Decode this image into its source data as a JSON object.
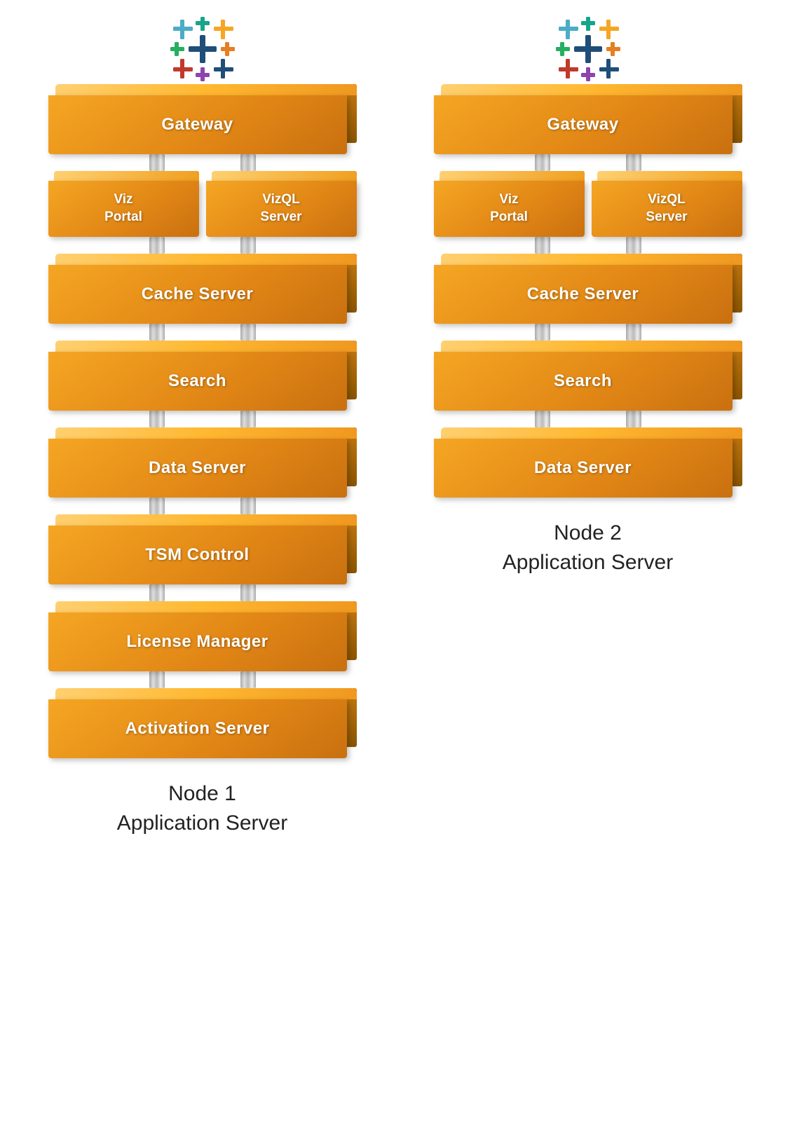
{
  "nodes": [
    {
      "id": "node1",
      "label_line1": "Node 1",
      "label_line2": "Application Server",
      "blocks": [
        {
          "id": "gateway1",
          "label": "Gateway",
          "type": "full",
          "variant": "orange"
        },
        {
          "id": "viz-portal1",
          "label": "Viz\nPortal",
          "type": "half-left",
          "variant": "orange"
        },
        {
          "id": "vizql1",
          "label": "VizQL\nServer",
          "type": "half-right",
          "variant": "orange"
        },
        {
          "id": "cache1",
          "label": "Cache Server",
          "type": "full",
          "variant": "orange"
        },
        {
          "id": "search1",
          "label": "Search",
          "type": "full",
          "variant": "orange"
        },
        {
          "id": "dataserver1",
          "label": "Data Server",
          "type": "full",
          "variant": "orange"
        },
        {
          "id": "tsm1",
          "label": "TSM Control",
          "type": "full",
          "variant": "orange"
        },
        {
          "id": "license1",
          "label": "License Manager",
          "type": "full",
          "variant": "orange"
        },
        {
          "id": "activation1",
          "label": "Activation Server",
          "type": "full",
          "variant": "orange"
        }
      ]
    },
    {
      "id": "node2",
      "label_line1": "Node 2",
      "label_line2": "Application Server",
      "blocks": [
        {
          "id": "gateway2",
          "label": "Gateway",
          "type": "full",
          "variant": "orange"
        },
        {
          "id": "viz-portal2",
          "label": "Viz\nPortal",
          "type": "half-left",
          "variant": "orange"
        },
        {
          "id": "vizql2",
          "label": "VizQL\nServer",
          "type": "half-right",
          "variant": "orange"
        },
        {
          "id": "cache2",
          "label": "Cache Server",
          "type": "full",
          "variant": "orange"
        },
        {
          "id": "search2",
          "label": "Search",
          "type": "full",
          "variant": "orange"
        },
        {
          "id": "dataserver2",
          "label": "Data Server",
          "type": "full",
          "variant": "orange"
        }
      ]
    }
  ],
  "colors": {
    "orange_main": "#f5a623",
    "orange_dark": "#c97010",
    "orange_light": "#ffd070",
    "background": "#ffffff",
    "text_white": "#ffffff",
    "text_dark": "#222222"
  }
}
